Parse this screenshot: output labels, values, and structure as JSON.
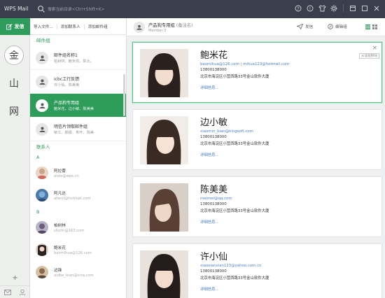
{
  "app": {
    "title": "WPS Mail"
  },
  "search": {
    "placeholder": "搜索当前目录<Ctrl+Shift+K>"
  },
  "rail": {
    "compose_label": "发信",
    "accounts": [
      {
        "label": "金"
      },
      {
        "label": "山"
      },
      {
        "label": "网"
      }
    ],
    "plus_label": "+"
  },
  "list_toolbar": {
    "import_label": "导入文件...",
    "add_contact_label": "添加联系人",
    "add_group_label": "添加邮件组"
  },
  "groups_section": {
    "header": "邮件组",
    "items": [
      {
        "name": "邮件组名称1",
        "sub": "柏树林、鲍米花、陈北、"
      },
      {
        "name": "icbc工行反馈",
        "sub": "许小仙、陈美美"
      },
      {
        "name": "产品狗专用组",
        "sub": "鲍米花、边小敏、陈美美"
      },
      {
        "name": "明信片领取邮件组",
        "sub": "柴江、颜俊、朱叶、陈美"
      }
    ]
  },
  "contacts_section": {
    "header": "联系人",
    "groups": [
      {
        "letter": "A",
        "items": [
          {
            "name": "阿拉蕾",
            "email": "alale@wps.cn"
          },
          {
            "name": "阿凡达",
            "email": "afanti@hotmail.com"
          }
        ]
      },
      {
        "letter": "B",
        "items": [
          {
            "name": "柏树林",
            "email": "shulin@163.com"
          },
          {
            "name": "鲍米花",
            "email": "baomihua@126.com"
          },
          {
            "name": "边锋",
            "email": "aidbe_bian@sina.com"
          }
        ]
      }
    ]
  },
  "detail": {
    "group_title": "产品狗专用组",
    "group_note": "(备注名)",
    "member_count": "Member:3",
    "send_label": "发信",
    "edit_label": "编辑组",
    "cards": [
      {
        "name": "鲍米花",
        "email": "baomihua@126.com",
        "email2": "mihua123@hotmail.com",
        "email_sep": " | ",
        "phone": "13800138000",
        "address": "北京市海淀区小营西路33号金山软件大厦",
        "more": "详细信息...",
        "close": "×",
        "tip": "从该组移除"
      },
      {
        "name": "边小敏",
        "email": "xiaomin_bian@kingsoft.com",
        "phone": "13800138000",
        "address": "北京市海淀区小营西路33号金山软件大厦",
        "more": "详细信息..."
      },
      {
        "name": "陈美美",
        "email": "meimei@qq.com",
        "phone": "13800138000",
        "address": "北京市海淀区小营西路33号金山软件大厦",
        "more": "详细信息..."
      },
      {
        "name": "许小仙",
        "email": "xiaoxianxian123@yahoo.com.cn",
        "phone": "13800138000",
        "address": "北京市海淀区小营西路33号金山软件大厦",
        "more": "详细信息..."
      }
    ]
  },
  "colors": {
    "accent": "#2e9c5b",
    "titlebar": "#3a3f4d",
    "link": "#4a7ec9"
  },
  "icons": [
    "search-icon",
    "help-icon",
    "info-icon",
    "shirt-icon",
    "settings-icon",
    "minimize-icon",
    "maximize-icon",
    "close-icon",
    "compose-icon",
    "send-icon",
    "edit-group-icon",
    "list-view-icon",
    "card-view-icon",
    "mail-icon",
    "contacts-icon",
    "group-icon"
  ]
}
